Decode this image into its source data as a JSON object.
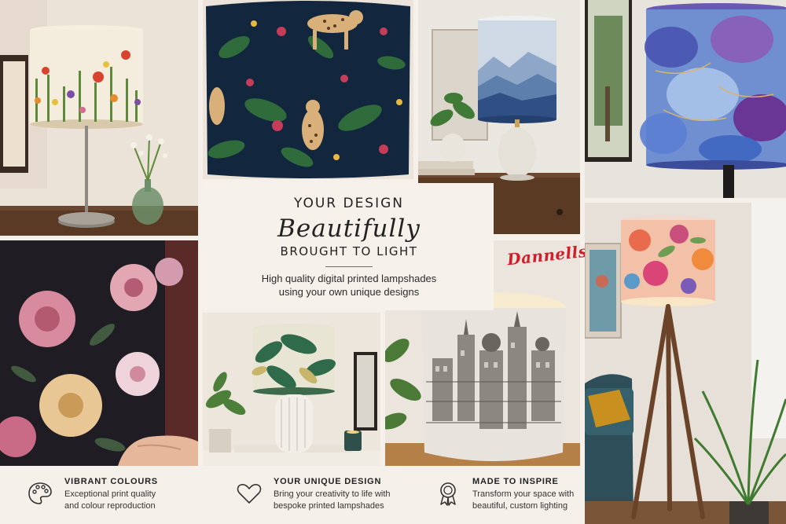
{
  "headline": {
    "line1": "YOUR DESIGN",
    "script": "Beautifully",
    "line2": "BROUGHT TO LIGHT"
  },
  "description": {
    "line1": "High quality digital printed lampshades",
    "line2": "using your own unique designs"
  },
  "brand": "Dannells",
  "features": [
    {
      "icon": "palette-icon",
      "title": "VIBRANT COLOURS",
      "line1": "Exceptional print quality",
      "line2": "and colour reproduction"
    },
    {
      "icon": "heart-icon",
      "title": "YOUR UNIQUE DESIGN",
      "line1": "Bring your creativity to life with",
      "line2": "bespoke printed lampshades"
    },
    {
      "icon": "award-ribbon-icon",
      "title": "MADE TO INSPIRE",
      "line1": "Transform your space with",
      "line2": "beautiful, custom lighting"
    }
  ],
  "colors": {
    "background": "#f6f0ea",
    "brand_red": "#d01f2b",
    "text": "#222222"
  }
}
